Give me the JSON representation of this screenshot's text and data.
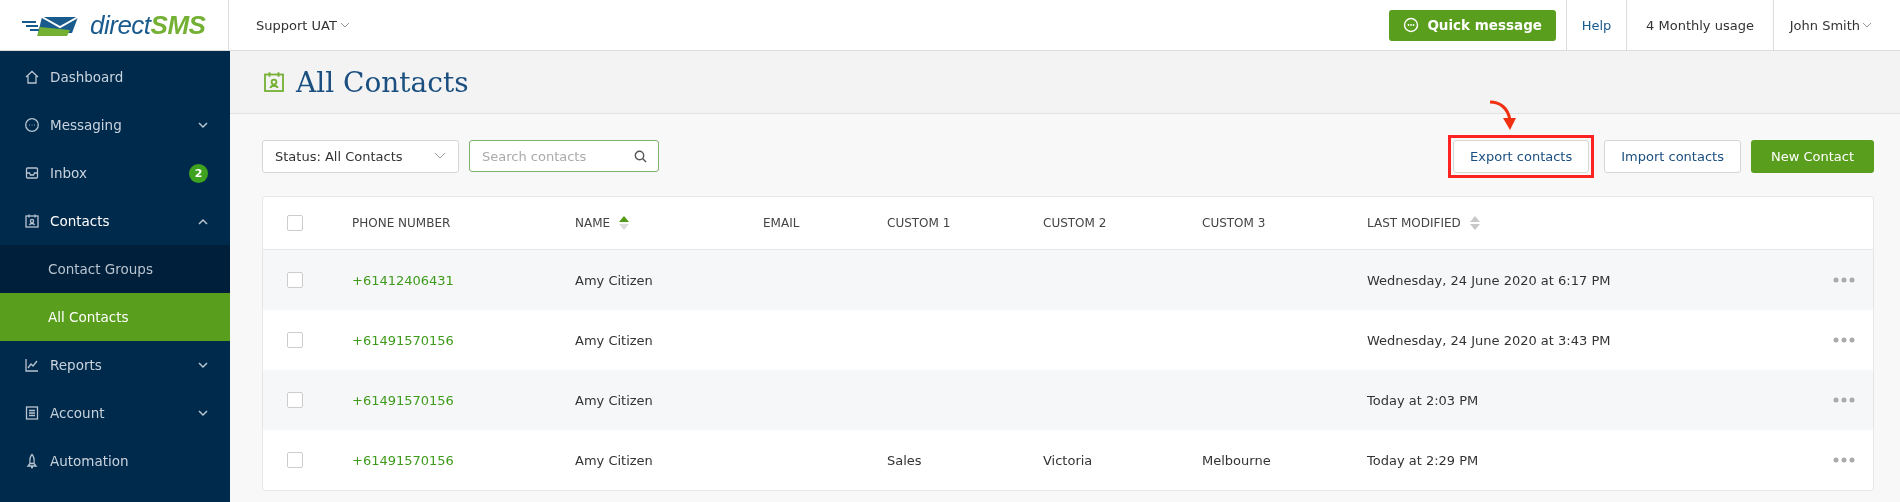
{
  "brand": {
    "name_plain": "direct",
    "name_bold": "SMS"
  },
  "topbar": {
    "account": "Support UAT",
    "quick_message": "Quick message",
    "help": "Help",
    "usage": "4 Monthly usage",
    "user": "John Smith"
  },
  "sidebar": {
    "items": [
      {
        "label": "Dashboard"
      },
      {
        "label": "Messaging",
        "expanded": false
      },
      {
        "label": "Inbox",
        "badge": "2"
      },
      {
        "label": "Contacts",
        "expanded": true,
        "children": [
          {
            "label": "Contact Groups",
            "selected": false
          },
          {
            "label": "All Contacts",
            "selected": true
          }
        ]
      },
      {
        "label": "Reports",
        "expanded": false
      },
      {
        "label": "Account",
        "expanded": false
      },
      {
        "label": "Automation"
      }
    ]
  },
  "page": {
    "title": "All Contacts"
  },
  "toolbar": {
    "status_filter": "Status: All Contacts",
    "search": {
      "placeholder": "Search contacts"
    },
    "buttons": [
      {
        "label": "Export contacts",
        "kind": "secondary",
        "highlighted": true
      },
      {
        "label": "Import contacts",
        "kind": "secondary",
        "highlighted": false
      },
      {
        "label": "New Contact",
        "kind": "primary",
        "highlighted": false
      }
    ]
  },
  "table": {
    "all_checked": false,
    "columns": [
      {
        "label": "PHONE NUMBER"
      },
      {
        "label": "NAME",
        "sorted": true
      },
      {
        "label": "EMAIL"
      },
      {
        "label": "CUSTOM 1"
      },
      {
        "label": "CUSTOM 2"
      },
      {
        "label": "CUSTOM 3"
      },
      {
        "label": "LAST MODIFIED",
        "sorted": false
      }
    ],
    "rows": [
      {
        "checked": false,
        "phone": "+61412406431",
        "name": "Amy Citizen",
        "last_modified": "Wednesday, 24 June 2020 at 6:17 PM"
      },
      {
        "checked": false,
        "phone": "+61491570156",
        "name": "Amy Citizen",
        "last_modified": "Wednesday, 24 June 2020 at 3:43 PM"
      },
      {
        "checked": false,
        "phone": "+61491570156",
        "name": "Amy Citizen",
        "last_modified": "Today at 2:03 PM"
      },
      {
        "checked": false,
        "phone": "+61491570156",
        "name": "Amy Citizen",
        "custom_1": "Sales",
        "custom_2": "Victoria",
        "custom_3": "Melbourne",
        "last_modified": "Today at 2:29 PM"
      }
    ]
  }
}
